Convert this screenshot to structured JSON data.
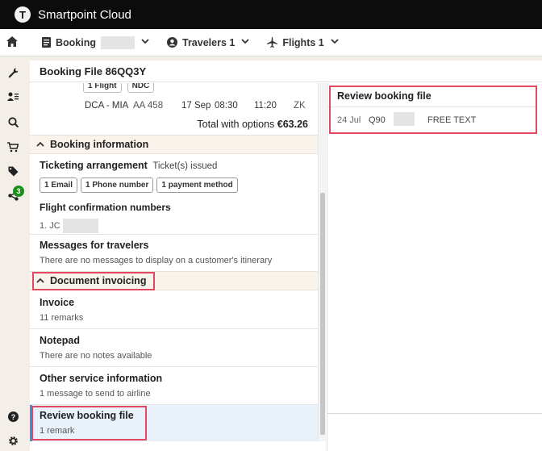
{
  "app": {
    "logo_letter": "T",
    "title": "Smartpoint Cloud"
  },
  "nav": {
    "booking_label": "Booking",
    "travelers_label": "Travelers 1",
    "flights_label": "Flights 1"
  },
  "sidebar": {
    "icons": [
      "wrench-icon",
      "contacts-icon",
      "search-icon",
      "cart-icon",
      "tag-icon",
      "share-icon"
    ],
    "share_badge": "3",
    "bottom_icons": [
      "help-icon",
      "settings-icon"
    ]
  },
  "booking_file": {
    "title": "Booking File 86QQ3Y"
  },
  "flight": {
    "tags": [
      "1 Flight",
      "NDC"
    ],
    "route": "DCA - MIA",
    "flight_no": "AA 458",
    "date": "17 Sep",
    "depart": "08:30",
    "arrive": "11:20",
    "class": "ZK",
    "total_label": "Total with options",
    "total_value": "€63.26"
  },
  "booking_information": {
    "header": "Booking information",
    "ticketing_label": "Ticketing arrangement",
    "ticketing_value": "Ticket(s) issued",
    "chips": [
      "1 Email",
      "1 Phone number",
      "1 payment method"
    ],
    "confirmation_label": "Flight confirmation numbers",
    "confirmation_value": "1. JC",
    "messages_label": "Messages for travelers",
    "messages_value": "There are no messages to display on a customer's itinerary"
  },
  "document_invoicing": {
    "header": "Document invoicing",
    "invoice_label": "Invoice",
    "invoice_sub": "11 remarks",
    "notepad_label": "Notepad",
    "notepad_sub": "There are no notes available",
    "osi_label": "Other service information",
    "osi_sub": "1 message to send to airline",
    "review_label": "Review booking file",
    "review_sub": "1 remark"
  },
  "review_panel": {
    "title": "Review booking file",
    "date": "24 Jul",
    "code": "Q90",
    "text": "FREE TEXT"
  },
  "colors": {
    "highlight": "#e0495f",
    "accent": "#1a8f1a",
    "topbar": "#0c0c0c"
  }
}
